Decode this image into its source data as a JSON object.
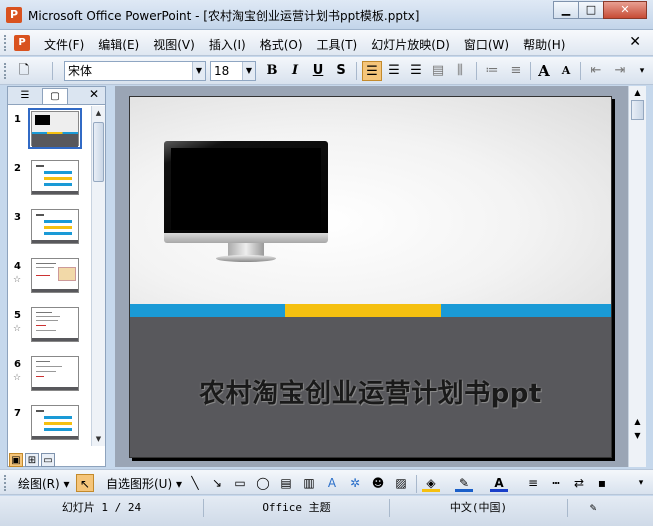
{
  "window": {
    "title": "Microsoft Office PowerPoint - [农村淘宝创业运营计划书ppt模板.pptx]",
    "app_icon": "powerpoint-icon",
    "minimize": "▁",
    "maximize": "□",
    "close": "✕"
  },
  "menu": {
    "items": [
      "文件(F)",
      "编辑(E)",
      "视图(V)",
      "插入(I)",
      "格式(O)",
      "工具(T)",
      "幻灯片放映(D)",
      "窗口(W)",
      "帮助(H)"
    ],
    "doc_close": "✕"
  },
  "format_toolbar": {
    "font_name": "宋体",
    "font_size": "18",
    "bold": "B",
    "italic": "I",
    "underline": "U",
    "shadow": "S",
    "grow_font": "A",
    "shrink_font": "A"
  },
  "left_pane": {
    "close": "✕",
    "slides": [
      {
        "num": "1",
        "star": ""
      },
      {
        "num": "2",
        "star": ""
      },
      {
        "num": "3",
        "star": ""
      },
      {
        "num": "4",
        "star": "☆"
      },
      {
        "num": "5",
        "star": "☆"
      },
      {
        "num": "6",
        "star": "☆"
      },
      {
        "num": "7",
        "star": ""
      }
    ]
  },
  "slide": {
    "title": "农村淘宝创业运营计划书ppt",
    "stripe_colors": [
      "#1a9ad6",
      "#f5c010",
      "#1a9ad6"
    ],
    "bottom_color": "#58585c"
  },
  "draw_toolbar": {
    "draw_label": "绘图(R)",
    "autoshapes_label": "自选图形(U)"
  },
  "status": {
    "slide_info": "幻灯片 1 / 24",
    "theme": "Office 主题",
    "language": "中文(中国)"
  }
}
